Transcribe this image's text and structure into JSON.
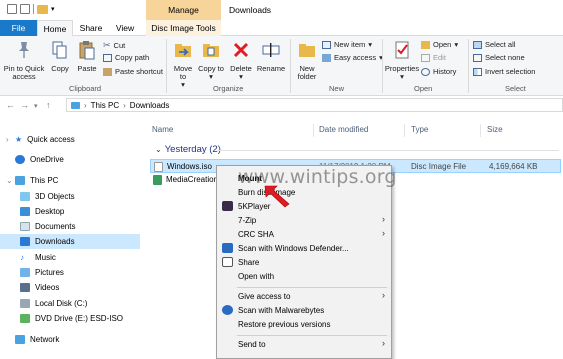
{
  "window": {
    "title": "Downloads",
    "context_tab": "Manage"
  },
  "tabs": [
    "File",
    "Home",
    "Share",
    "View",
    "Disc Image Tools"
  ],
  "ribbon": {
    "clipboard": {
      "pin": "Pin to Quick access",
      "copy": "Copy",
      "paste": "Paste",
      "cut": "Cut",
      "copy_path": "Copy path",
      "paste_shortcut": "Paste shortcut",
      "label": "Clipboard"
    },
    "organize": {
      "move_to": "Move to",
      "copy_to": "Copy to",
      "delete": "Delete",
      "rename": "Rename",
      "label": "Organize"
    },
    "new": {
      "new_folder": "New folder",
      "new_item": "New item",
      "easy_access": "Easy access",
      "label": "New"
    },
    "open": {
      "properties": "Properties",
      "open": "Open",
      "edit": "Edit",
      "history": "History",
      "label": "Open"
    },
    "select": {
      "select_all": "Select all",
      "select_none": "Select none",
      "invert": "Invert selection",
      "label": "Select"
    }
  },
  "address": {
    "crumbs": [
      "This PC",
      "Downloads"
    ]
  },
  "nav_pane": {
    "quick_access": "Quick access",
    "onedrive": "OneDrive",
    "this_pc": "This PC",
    "items": [
      "3D Objects",
      "Desktop",
      "Documents",
      "Downloads",
      "Music",
      "Pictures",
      "Videos",
      "Local Disk (C:)",
      "DVD Drive (E:) ESD-ISO"
    ],
    "network": "Network"
  },
  "columns": [
    "Name",
    "Date modified",
    "Type",
    "Size"
  ],
  "group": "Yesterday (2)",
  "files": [
    {
      "name": "Windows.iso",
      "date": "11/17/2019 1:20 PM",
      "type": "Disc Image File",
      "size": "4,169,664 KB"
    },
    {
      "name": "MediaCreation",
      "date": "",
      "type": "",
      "size": ""
    }
  ],
  "context_menu": [
    "Mount",
    "Burn disc image",
    "5KPlayer",
    "7-Zip",
    "CRC SHA",
    "Scan with Windows Defender...",
    "Share",
    "Open with",
    "Give access to",
    "Scan with Malwarebytes",
    "Restore previous versions",
    "Send to"
  ],
  "watermark": "www.wintips.org",
  "colors": {
    "file_tab": "#1979ca",
    "manage_tab": "#f7d59a",
    "selection": "#cce8ff",
    "group_header": "#1e3287",
    "delete_icon": "#e01b24"
  }
}
